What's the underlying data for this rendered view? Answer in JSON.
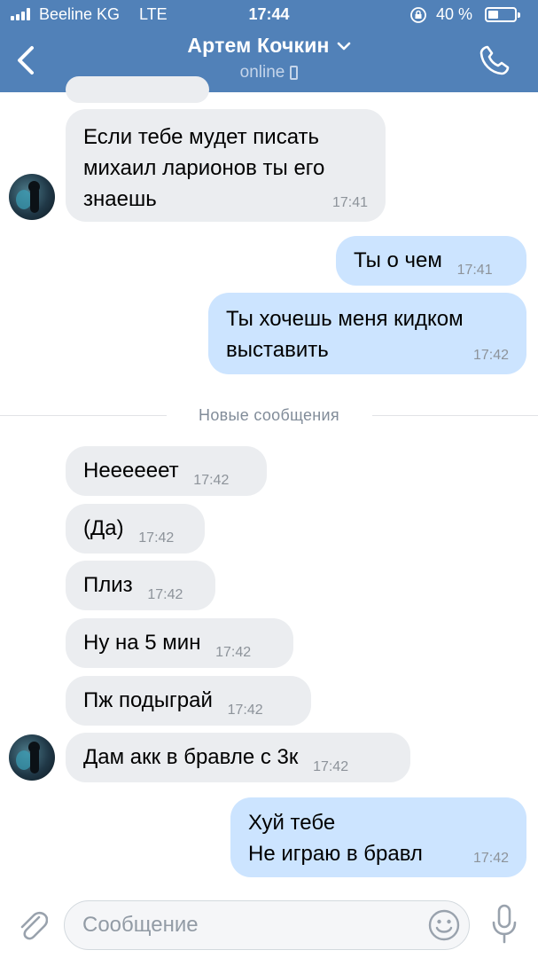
{
  "status_bar": {
    "carrier": "Beeline KG",
    "network": "LTE",
    "time": "17:44",
    "battery_percent": "40 %",
    "battery_level": 0.4
  },
  "header": {
    "contact_name": "Артем Кочкин",
    "contact_status": "online"
  },
  "messages": [
    {
      "text": "Если тебе мудет писать\nмихаил ларионов ты его\nзнаешь",
      "time": "17:41"
    },
    {
      "text": "Ты о чем",
      "time": "17:41"
    },
    {
      "text": "Ты хочешь меня кидком\nвыставить",
      "time": "17:42"
    },
    {
      "text": "Неееееет",
      "time": "17:42"
    },
    {
      "text": "(Да)",
      "time": "17:42"
    },
    {
      "text": "Плиз",
      "time": "17:42"
    },
    {
      "text": "Ну на 5 мин",
      "time": "17:42"
    },
    {
      "text": "Пж подыграй",
      "time": "17:42"
    },
    {
      "text": "Дам акк в бравле с 3к",
      "time": "17:42"
    },
    {
      "text": "Хуй тебе\nНе играю в бравл",
      "time": "17:42"
    }
  ],
  "divider_label": "Новые сообщения",
  "composer": {
    "placeholder": "Сообщение"
  },
  "colors": {
    "header_bg": "#5181b8",
    "incoming_bubble": "#ebedf0",
    "outgoing_bubble": "#cce4ff"
  },
  "icons": [
    "signal-icon",
    "lock-rotation-icon",
    "battery-icon",
    "back-chevron-icon",
    "chevron-down-icon",
    "phone-icon",
    "paperclip-icon",
    "emoji-icon",
    "microphone-icon"
  ]
}
